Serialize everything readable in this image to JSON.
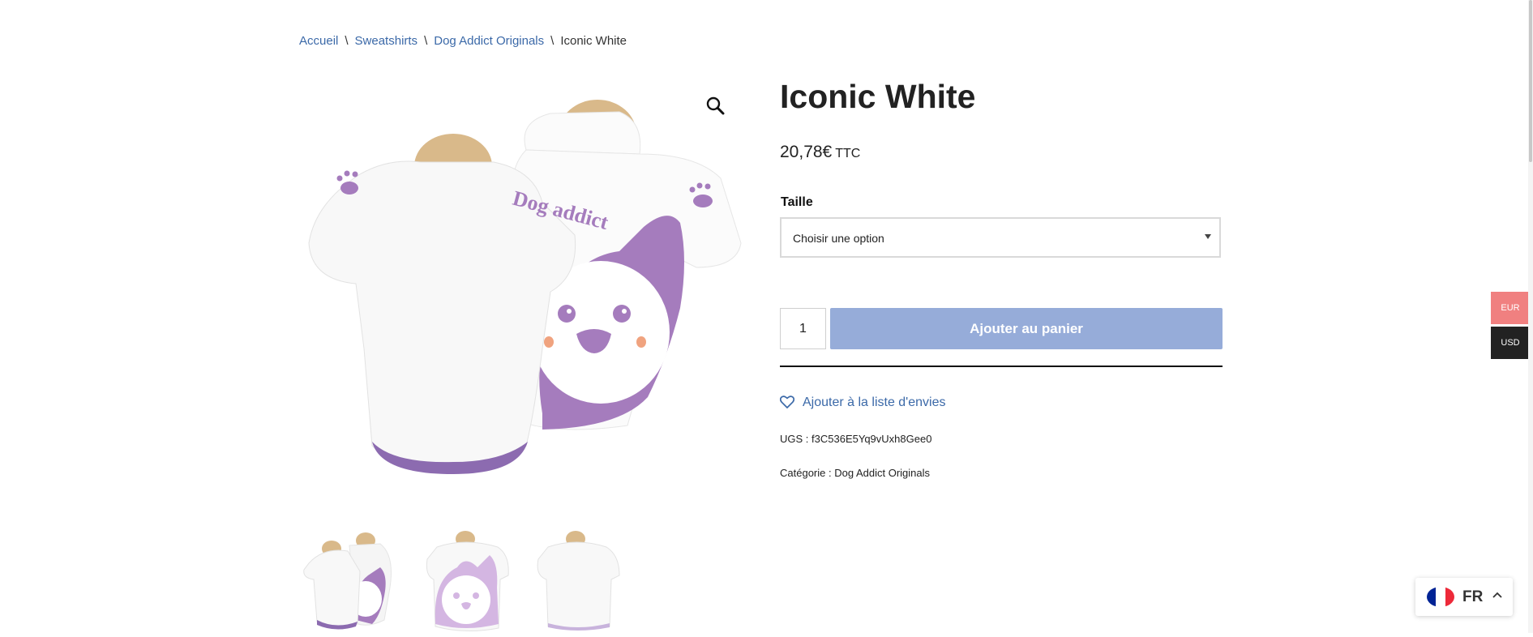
{
  "breadcrumb": {
    "items": [
      "Accueil",
      "Sweatshirts",
      "Dog Addict Originals"
    ],
    "separator": "\\",
    "current": "Iconic White"
  },
  "product": {
    "title": "Iconic White",
    "price": "20,78€",
    "price_suffix": "TTC",
    "size_label": "Taille",
    "size_select_value": "Choisir une option",
    "quantity": "1",
    "add_to_cart_label": "Ajouter au panier",
    "wishlist_label": "Ajouter à la liste d'envies",
    "sku_label": "UGS :",
    "sku": "f3C536E5Yq9vUxh8Gee0",
    "category_label": "Catégorie :",
    "category": "Dog Addict Originals",
    "image_text": "Dog addict"
  },
  "gallery": {
    "zoom_icon": "magnifier-icon",
    "thumbnails": [
      "thumb-front-back",
      "thumb-back",
      "thumb-front"
    ]
  },
  "currency_switcher": {
    "options": [
      "EUR",
      "USD"
    ],
    "selected": "EUR",
    "colors": {
      "EUR": "#f08080",
      "USD": "#222222"
    }
  },
  "language_switcher": {
    "code": "FR",
    "flag_colors": [
      "#002395",
      "#ffffff",
      "#ed2939"
    ]
  },
  "colors": {
    "link": "#3b69a8",
    "add_to_cart_bg": "#96acd9",
    "hoodie_purple": "#a57cbd"
  }
}
